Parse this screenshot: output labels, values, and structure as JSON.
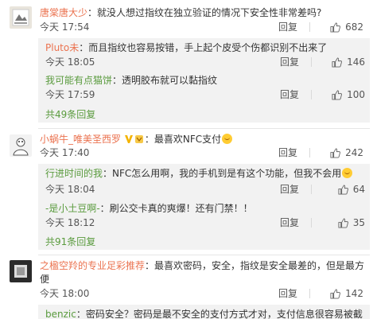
{
  "comments": [
    {
      "user": "唐棠唐大少",
      "text": "：就没人想过指纹在独立验证的情况下安全性非常差吗?",
      "time": "今天 17:54",
      "reply": "回复",
      "likes": "682",
      "replies": [
        {
          "user": "Pluto未",
          "text": "：而且指纹也容易按错，手上起个皮受个伤都识别不出来了",
          "time": "今天 18:05",
          "reply": "回复",
          "likes": "146"
        },
        {
          "user": "我可能有点猫饼",
          "text": "：透明胶布就可以黏指纹",
          "time": "今天 17:59",
          "reply": "回复",
          "likes": "100"
        }
      ],
      "more": "共49条回复"
    },
    {
      "user": "小蜗牛_唯美圣西罗",
      "text": "：最喜欢NFC支付",
      "time": "今天 17:40",
      "reply": "回复",
      "likes": "242",
      "replies": [
        {
          "user": "行进时间的我",
          "text": "：NFC怎么用啊，我的手机到是有这个功能，但我不会用",
          "time": "今天 18:04",
          "reply": "回复",
          "likes": "64"
        },
        {
          "user": "-是小土豆啊-",
          "text": "：刷公交卡真的爽爆！还有门禁！！",
          "time": "今天 18:12",
          "reply": "回复",
          "likes": "35"
        }
      ],
      "more": "共91条回复"
    },
    {
      "user": "之楹空羚的专业足彩推荐",
      "text": "：最喜欢密码，安全，指纹是安全最差的，但是最方便",
      "time": "今天 18:00",
      "reply": "回复",
      "likes": "142",
      "replies": [
        {
          "user": "benzic",
          "text": "：密码安全？密码是最不安全的支付方式才对，支付信息很容易被截",
          "time": "",
          "reply": "",
          "likes": ""
        }
      ]
    }
  ]
}
